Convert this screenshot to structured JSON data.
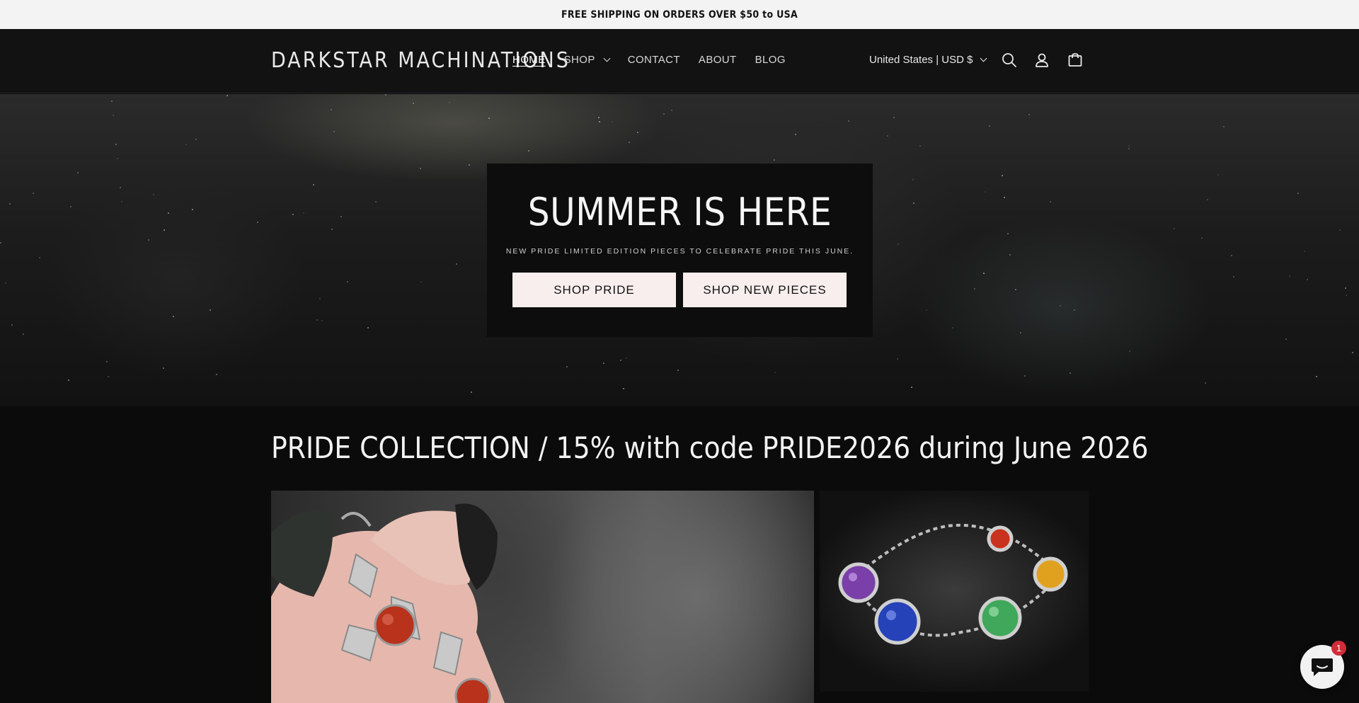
{
  "announcement": "FREE SHIPPING ON ORDERS OVER $50 to USA",
  "header": {
    "logo": "DARKSTAR MACHINATIONS",
    "nav": [
      {
        "label": "HOME"
      },
      {
        "label": "SHOP"
      },
      {
        "label": "CONTACT"
      },
      {
        "label": "ABOUT"
      },
      {
        "label": "BLOG"
      }
    ],
    "locale": "United States | USD $",
    "icons": [
      "search-icon",
      "account-icon",
      "cart-icon"
    ]
  },
  "hero": {
    "title": "SUMMER IS HERE",
    "subtitle": "NEW PRIDE LIMITED EDITION PIECES TO CELEBRATE PRIDE THIS JUNE.",
    "buttons": [
      {
        "label": "SHOP PRIDE"
      },
      {
        "label": "SHOP NEW PIECES"
      }
    ]
  },
  "collection": {
    "title": "PRIDE COLLECTION / 15% with code PRIDE2026 during June 2026"
  },
  "chat": {
    "badge": "1",
    "icon": "chat-icon"
  },
  "colors": {
    "background": "#0b0b0b",
    "header": "#121212",
    "announcement_bg": "#f3f3f3",
    "button_bg": "#f8eeee",
    "badge": "#d22c3a"
  }
}
